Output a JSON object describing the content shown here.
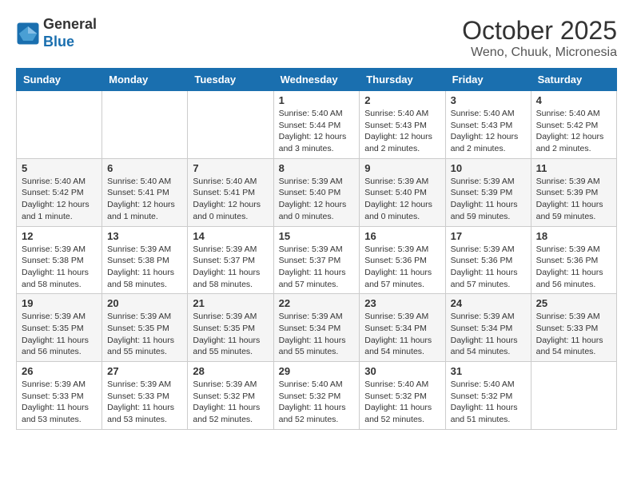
{
  "header": {
    "logo_line1": "General",
    "logo_line2": "Blue",
    "month": "October 2025",
    "location": "Weno, Chuuk, Micronesia"
  },
  "days_of_week": [
    "Sunday",
    "Monday",
    "Tuesday",
    "Wednesday",
    "Thursday",
    "Friday",
    "Saturday"
  ],
  "weeks": [
    [
      {
        "day": "",
        "info": ""
      },
      {
        "day": "",
        "info": ""
      },
      {
        "day": "",
        "info": ""
      },
      {
        "day": "1",
        "info": "Sunrise: 5:40 AM\nSunset: 5:44 PM\nDaylight: 12 hours and 3 minutes."
      },
      {
        "day": "2",
        "info": "Sunrise: 5:40 AM\nSunset: 5:43 PM\nDaylight: 12 hours and 2 minutes."
      },
      {
        "day": "3",
        "info": "Sunrise: 5:40 AM\nSunset: 5:43 PM\nDaylight: 12 hours and 2 minutes."
      },
      {
        "day": "4",
        "info": "Sunrise: 5:40 AM\nSunset: 5:42 PM\nDaylight: 12 hours and 2 minutes."
      }
    ],
    [
      {
        "day": "5",
        "info": "Sunrise: 5:40 AM\nSunset: 5:42 PM\nDaylight: 12 hours and 1 minute."
      },
      {
        "day": "6",
        "info": "Sunrise: 5:40 AM\nSunset: 5:41 PM\nDaylight: 12 hours and 1 minute."
      },
      {
        "day": "7",
        "info": "Sunrise: 5:40 AM\nSunset: 5:41 PM\nDaylight: 12 hours and 0 minutes."
      },
      {
        "day": "8",
        "info": "Sunrise: 5:39 AM\nSunset: 5:40 PM\nDaylight: 12 hours and 0 minutes."
      },
      {
        "day": "9",
        "info": "Sunrise: 5:39 AM\nSunset: 5:40 PM\nDaylight: 12 hours and 0 minutes."
      },
      {
        "day": "10",
        "info": "Sunrise: 5:39 AM\nSunset: 5:39 PM\nDaylight: 11 hours and 59 minutes."
      },
      {
        "day": "11",
        "info": "Sunrise: 5:39 AM\nSunset: 5:39 PM\nDaylight: 11 hours and 59 minutes."
      }
    ],
    [
      {
        "day": "12",
        "info": "Sunrise: 5:39 AM\nSunset: 5:38 PM\nDaylight: 11 hours and 58 minutes."
      },
      {
        "day": "13",
        "info": "Sunrise: 5:39 AM\nSunset: 5:38 PM\nDaylight: 11 hours and 58 minutes."
      },
      {
        "day": "14",
        "info": "Sunrise: 5:39 AM\nSunset: 5:37 PM\nDaylight: 11 hours and 58 minutes."
      },
      {
        "day": "15",
        "info": "Sunrise: 5:39 AM\nSunset: 5:37 PM\nDaylight: 11 hours and 57 minutes."
      },
      {
        "day": "16",
        "info": "Sunrise: 5:39 AM\nSunset: 5:36 PM\nDaylight: 11 hours and 57 minutes."
      },
      {
        "day": "17",
        "info": "Sunrise: 5:39 AM\nSunset: 5:36 PM\nDaylight: 11 hours and 57 minutes."
      },
      {
        "day": "18",
        "info": "Sunrise: 5:39 AM\nSunset: 5:36 PM\nDaylight: 11 hours and 56 minutes."
      }
    ],
    [
      {
        "day": "19",
        "info": "Sunrise: 5:39 AM\nSunset: 5:35 PM\nDaylight: 11 hours and 56 minutes."
      },
      {
        "day": "20",
        "info": "Sunrise: 5:39 AM\nSunset: 5:35 PM\nDaylight: 11 hours and 55 minutes."
      },
      {
        "day": "21",
        "info": "Sunrise: 5:39 AM\nSunset: 5:35 PM\nDaylight: 11 hours and 55 minutes."
      },
      {
        "day": "22",
        "info": "Sunrise: 5:39 AM\nSunset: 5:34 PM\nDaylight: 11 hours and 55 minutes."
      },
      {
        "day": "23",
        "info": "Sunrise: 5:39 AM\nSunset: 5:34 PM\nDaylight: 11 hours and 54 minutes."
      },
      {
        "day": "24",
        "info": "Sunrise: 5:39 AM\nSunset: 5:34 PM\nDaylight: 11 hours and 54 minutes."
      },
      {
        "day": "25",
        "info": "Sunrise: 5:39 AM\nSunset: 5:33 PM\nDaylight: 11 hours and 54 minutes."
      }
    ],
    [
      {
        "day": "26",
        "info": "Sunrise: 5:39 AM\nSunset: 5:33 PM\nDaylight: 11 hours and 53 minutes."
      },
      {
        "day": "27",
        "info": "Sunrise: 5:39 AM\nSunset: 5:33 PM\nDaylight: 11 hours and 53 minutes."
      },
      {
        "day": "28",
        "info": "Sunrise: 5:39 AM\nSunset: 5:32 PM\nDaylight: 11 hours and 52 minutes."
      },
      {
        "day": "29",
        "info": "Sunrise: 5:40 AM\nSunset: 5:32 PM\nDaylight: 11 hours and 52 minutes."
      },
      {
        "day": "30",
        "info": "Sunrise: 5:40 AM\nSunset: 5:32 PM\nDaylight: 11 hours and 52 minutes."
      },
      {
        "day": "31",
        "info": "Sunrise: 5:40 AM\nSunset: 5:32 PM\nDaylight: 11 hours and 51 minutes."
      },
      {
        "day": "",
        "info": ""
      }
    ]
  ]
}
